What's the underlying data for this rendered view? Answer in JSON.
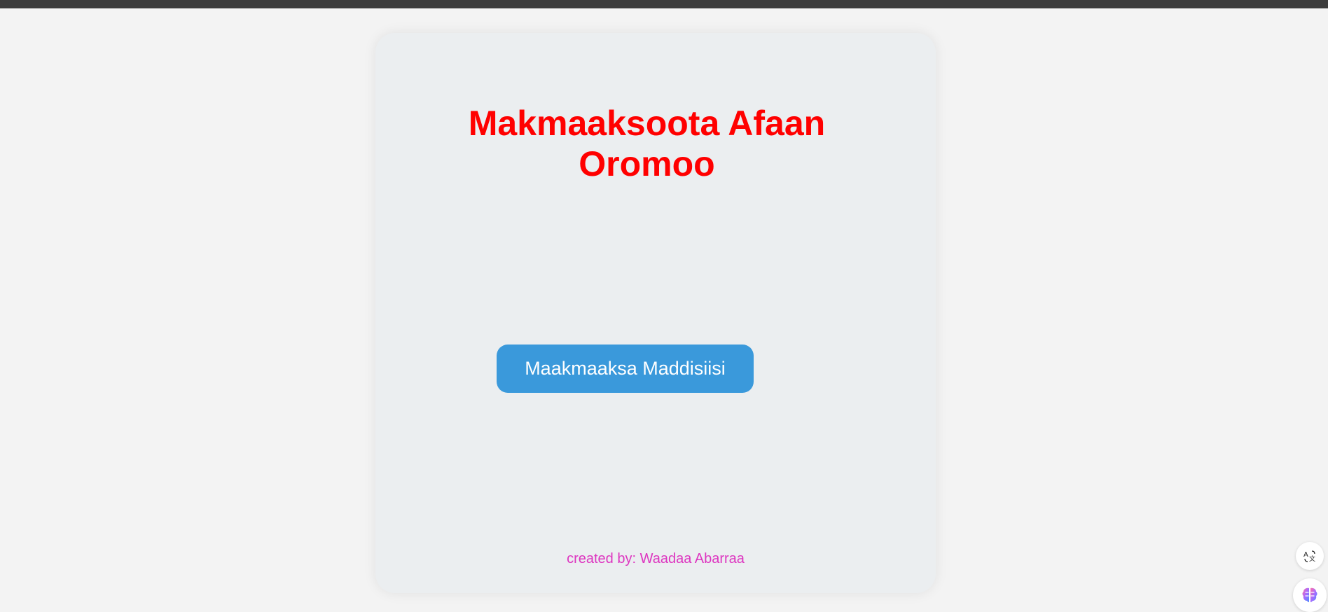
{
  "page": {
    "title": "Makmaaksoota Afaan Oromoo",
    "start_button_label": "Maakmaaksa Maddisiisi",
    "credit": "created by: Waadaa Abarraa"
  },
  "floating": {
    "translate_icon": "translate-icon",
    "brain_icon": "brain-icon"
  },
  "colors": {
    "title": "#ff0000",
    "button": "#3a99db",
    "credit": "#dd35c0",
    "card": "#ebeef0"
  }
}
